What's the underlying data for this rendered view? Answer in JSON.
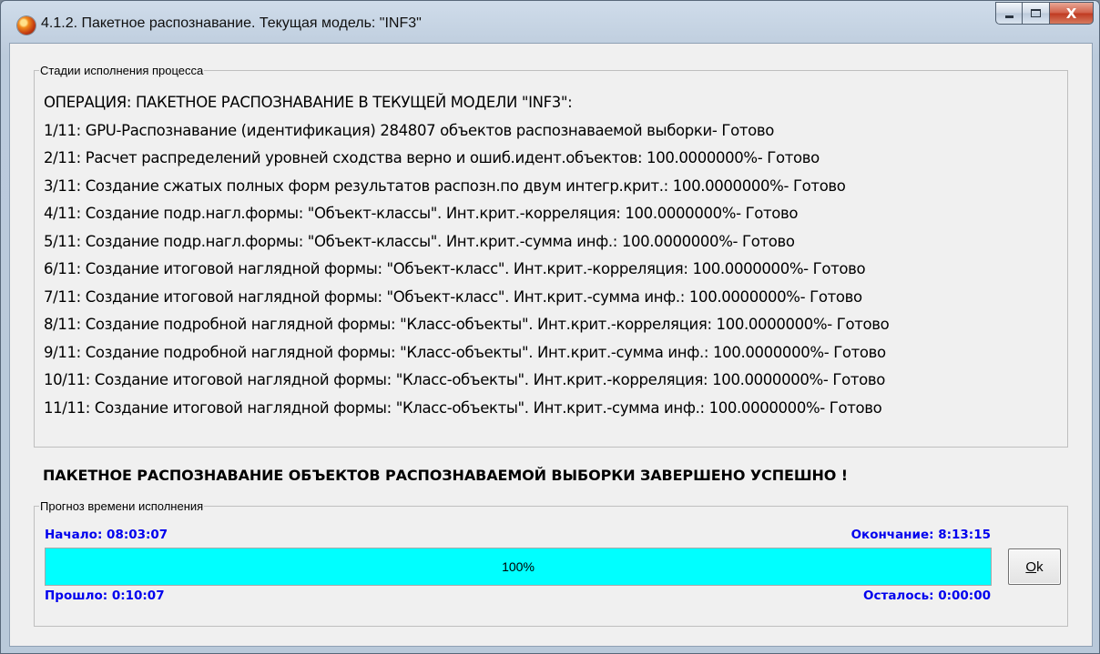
{
  "window": {
    "title": "4.1.2. Пакетное распознавание. Текущая модель: \"INF3\"",
    "close_label": "X"
  },
  "stages_group": {
    "legend": "Стадии исполнения процесса",
    "lines": [
      "ОПЕРАЦИЯ: ПАКЕТНОЕ РАСПОЗНАВАНИЕ В ТЕКУЩЕЙ МОДЕЛИ \"INF3\":",
      "1/11: GPU-Распознавание (идентификация) 284807 объектов распознаваемой выборки- Готово",
      "2/11: Расчет распределений уровней сходства верно и ошиб.идент.объектов: 100.0000000%- Готово",
      "3/11: Создание сжатых полных форм результатов распозн.по двум интегр.крит.: 100.0000000%- Готово",
      "4/11: Создание подр.нагл.формы: \"Объект-классы\". Инт.крит.-корреляция: 100.0000000%- Готово",
      "5/11: Создание подр.нагл.формы: \"Объект-классы\". Инт.крит.-сумма инф.: 100.0000000%- Готово",
      "6/11: Создание итоговой наглядной формы: \"Объект-класс\". Инт.крит.-корреляция: 100.0000000%- Готово",
      "7/11: Создание итоговой наглядной формы: \"Объект-класс\". Инт.крит.-сумма инф.: 100.0000000%- Готово",
      "8/11: Создание подробной наглядной формы: \"Класс-объекты\". Инт.крит.-корреляция: 100.0000000%- Готово",
      "9/11: Создание подробной наглядной формы: \"Класс-объекты\". Инт.крит.-сумма инф.: 100.0000000%- Готово",
      "10/11: Создание итоговой наглядной формы: \"Класс-объекты\". Инт.крит.-корреляция: 100.0000000%- Готово",
      "11/11: Создание итоговой наглядной формы: \"Класс-объекты\". Инт.крит.-сумма инф.: 100.0000000%- Готово"
    ]
  },
  "completion_message": "ПАКЕТНОЕ РАСПОЗНАВАНИЕ ОБЪЕКТОВ РАСПОЗНАВАЕМОЙ ВЫБОРКИ ЗАВЕРШЕНО УСПЕШНО !",
  "forecast_group": {
    "legend": "Прогноз времени исполнения",
    "start_label": "Начало: 08:03:07",
    "end_label": "Окончание: 8:13:15",
    "elapsed_label": "Прошло: 0:10:07",
    "remaining_label": "Осталось: 0:00:00",
    "progress_text": "100%",
    "progress_fraction": 1.0
  },
  "ok_button": {
    "mnemonic": "O",
    "rest": "k"
  },
  "colors": {
    "progress_fill": "#00ffff",
    "time_label": "#0000ee"
  }
}
